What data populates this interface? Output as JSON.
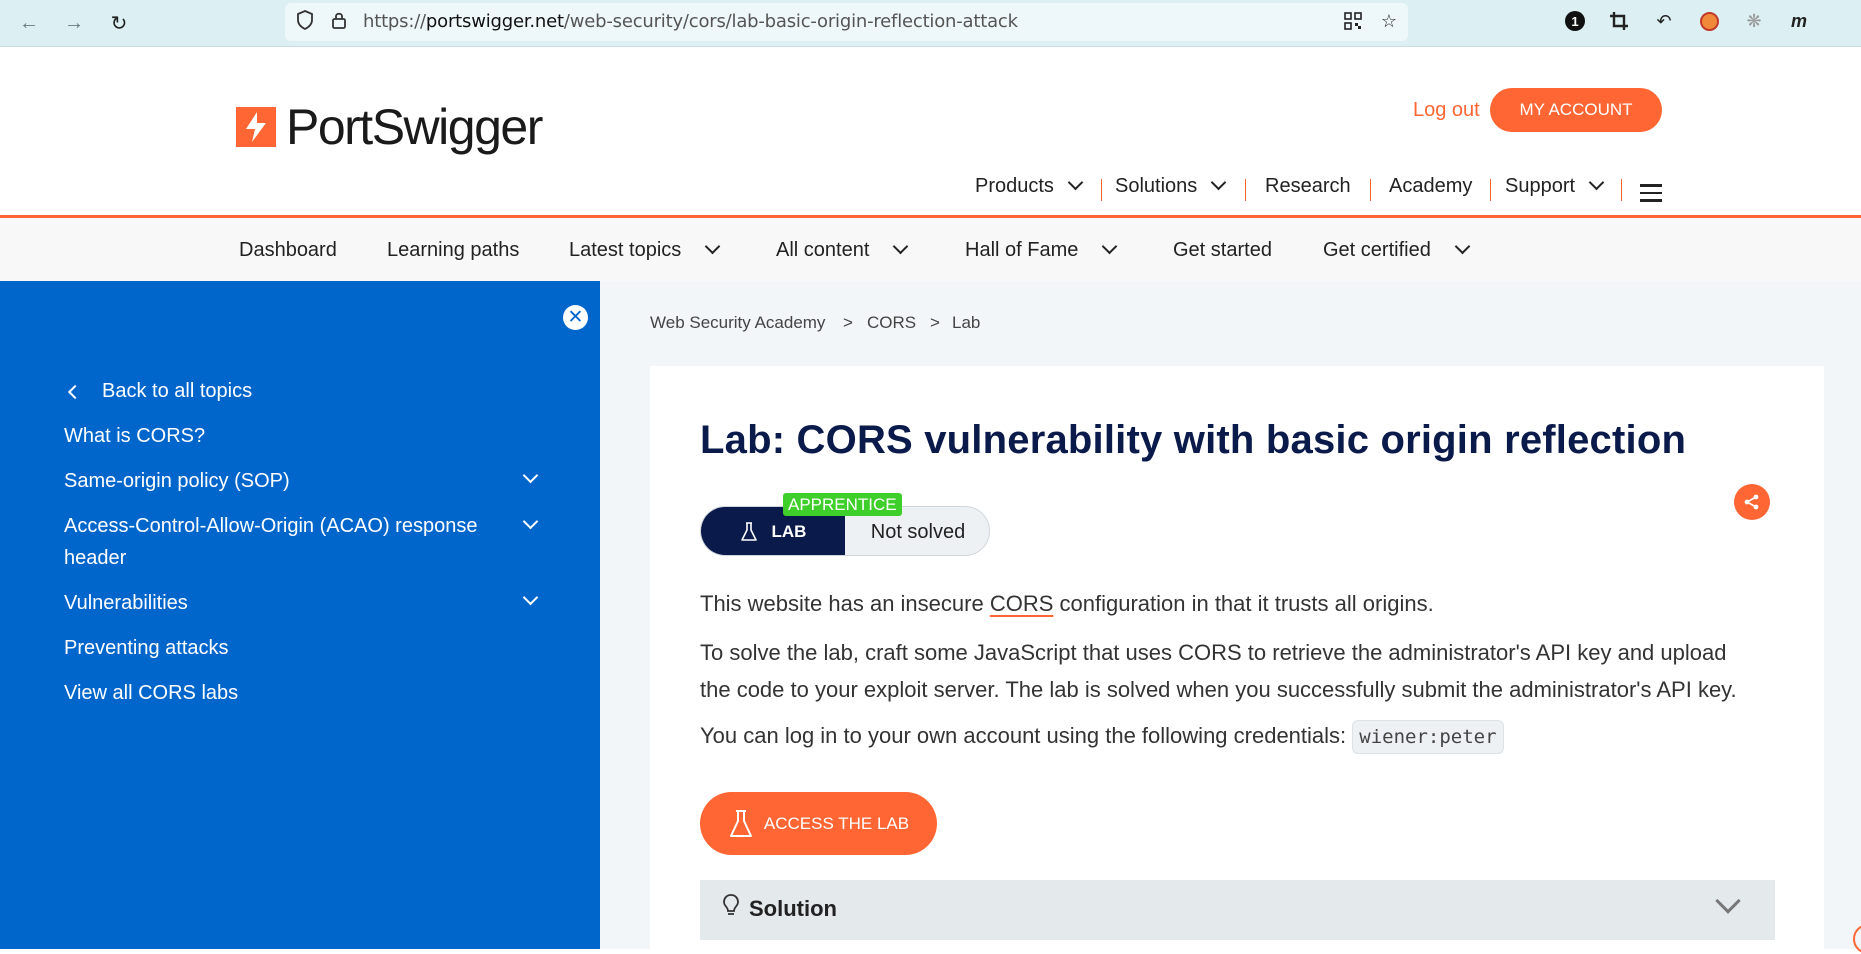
{
  "browser": {
    "url_prefix": "https://",
    "url_host": "portswigger.net",
    "url_path": "/web-security/cors/lab-basic-origin-reflection-attack",
    "badge_count": "1"
  },
  "header": {
    "logo_text": "PortSwigger",
    "logout": "Log out",
    "my_account": "MY ACCOUNT",
    "nav": [
      "Products",
      "Solutions",
      "Research",
      "Academy",
      "Support"
    ]
  },
  "subnav": [
    "Dashboard",
    "Learning paths",
    "Latest topics",
    "All content",
    "Hall of Fame",
    "Get started",
    "Get certified"
  ],
  "sidebar": {
    "back": "Back to all topics",
    "items": [
      "What is CORS?",
      "Same-origin policy (SOP)",
      "Access-Control-Allow-Origin (ACAO) response",
      "header",
      "Vulnerabilities",
      "Preventing attacks",
      "View all CORS labs"
    ]
  },
  "breadcrumb": {
    "root": "Web Security Academy",
    "section": "CORS",
    "page": "Lab",
    "separator": ">"
  },
  "lab": {
    "title": "Lab: CORS vulnerability with basic origin reflection",
    "level": "APPRENTICE",
    "tag": "LAB",
    "status": "Not solved",
    "p1_before": "This website has an insecure ",
    "p1_link": "CORS",
    "p1_after": " configuration in that it trusts all origins.",
    "p2_line1": "To solve the lab, craft some JavaScript that uses CORS to retrieve the administrator's API key and upload",
    "p2_line2": "the code to your exploit server. The lab is solved when you successfully submit the administrator's API key.",
    "p3_text": "You can log in to your own account using the following credentials: ",
    "credentials": "wiener:peter",
    "access_button": "ACCESS THE LAB",
    "solution_label": "Solution"
  },
  "colors": {
    "accent": "#ff6633",
    "sidebar": "#0066cc",
    "navy": "#0a1a4a",
    "apprentice": "#3fcf2a"
  }
}
